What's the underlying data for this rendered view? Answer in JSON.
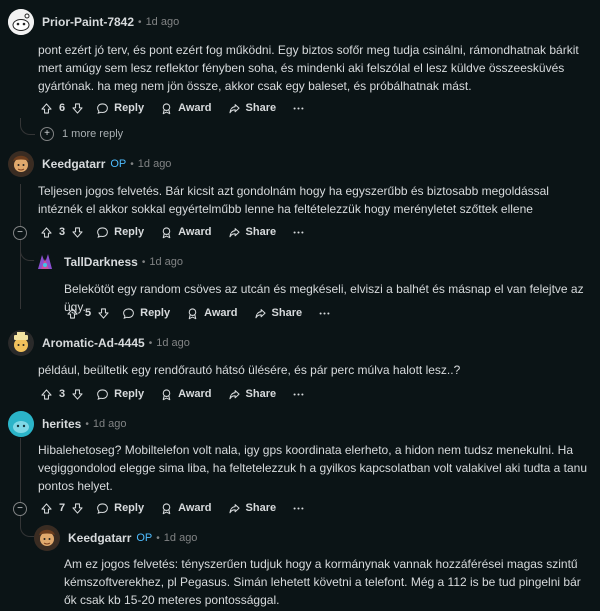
{
  "comments": [
    {
      "username": "Prior-Paint-7842",
      "time": "1d ago",
      "body": "pont ezért jó terv, és pont ezért fog működni. Egy biztos sofőr meg tudja csinálni, rámondhatnak bárkit mert amúgy sem lesz reflektor fényben soha, és mindenki aki felszólal el lesz küldve összeesküvés gyártónak. ha meg nem jön össze, akkor csak egy baleset, és próbálhatnak mást.",
      "votes": "6",
      "more_replies": "1 more reply"
    },
    {
      "username": "Keedgatarr",
      "op": "OP",
      "time": "1d ago",
      "body": "Teljesen jogos felvetés. Bár kicsit azt gondolnám hogy ha egyszerűbb és biztosabb megoldással intéznék el akkor sokkal egyértelműbb lenne ha feltételezzük hogy merényletet szőttek ellene",
      "votes": "3"
    },
    {
      "username": "TallDarkness",
      "time": "1d ago",
      "body": "Belekötöt egy random csöves az utcán és megkéseli, elviszi a balhét és másnap el van felejtve az ügy.",
      "votes": "5"
    },
    {
      "username": "Aromatic-Ad-4445",
      "time": "1d ago",
      "body": "például, beültetik egy rendőrautó hátsó ülésére, és pár perc múlva halott lesz..?",
      "votes": "3"
    },
    {
      "username": "herites",
      "time": "1d ago",
      "body": "Hibalehetoseg? Mobiltelefon volt nala, igy gps koordinata elerheto, a hidon nem tudsz menekulni. Ha vegiggondolod elegge sima liba, ha feltetelezzuk h a gyilkos kapcsolatban volt valakivel aki tudta a tanu pontos helyet.",
      "votes": "7"
    },
    {
      "username": "Keedgatarr",
      "op": "OP",
      "time": "1d ago",
      "body": "Am ez jogos felvetés: tényszerűen tudjuk hogy a kormánynak vannak hozzáférései magas szintű kémszoftverekhez, pl Pegasus. Simán lehetett követni a telefont. Még a 112 is be tud pingelni bár ők csak kb 15-20 meteres pontossággal."
    }
  ],
  "actions": {
    "reply": "Reply",
    "award": "Award",
    "share": "Share",
    "more": "..."
  },
  "icons": {
    "upvote": "arrow-up-icon",
    "downvote": "arrow-down-icon",
    "reply": "comment-bubble-icon",
    "award": "award-ribbon-icon",
    "share": "share-arrow-icon",
    "more": "more-horizontal-icon",
    "collapse": "collapse-minus-icon",
    "expand": "expand-plus-icon"
  },
  "colors": {
    "background": "#0b1416",
    "text": "#d7dadc",
    "muted": "#818384",
    "op_badge": "#4fbcff",
    "thread_line": "#343536"
  }
}
